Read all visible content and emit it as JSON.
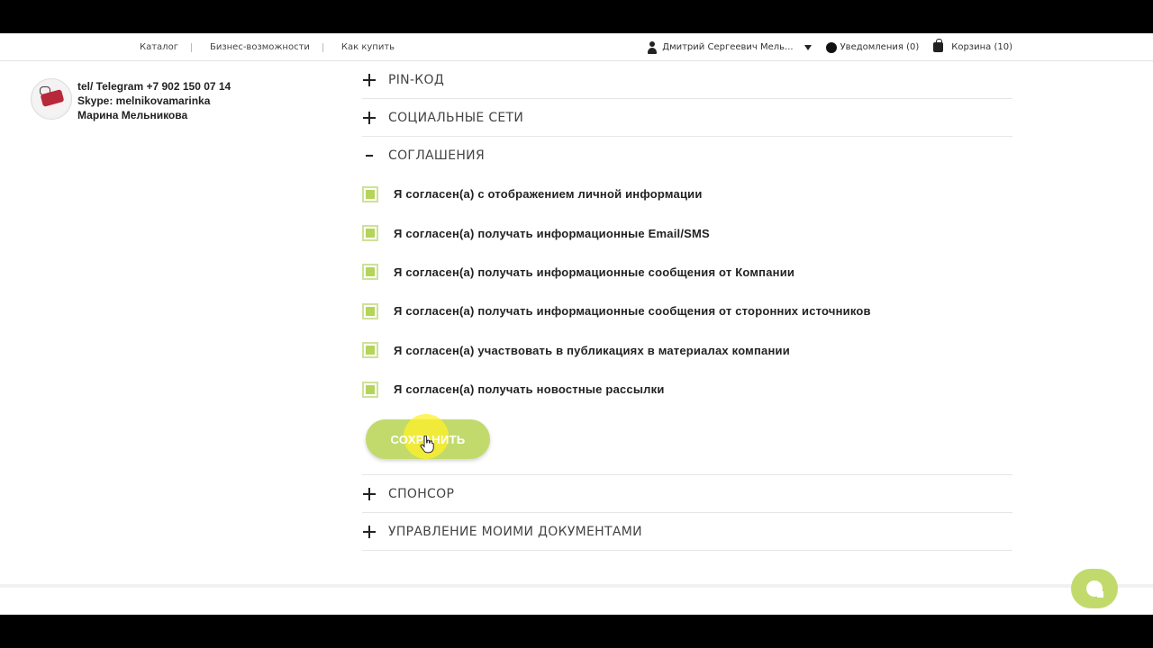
{
  "topnav": {
    "links": [
      "Каталог",
      "Бизнес-возможности",
      "Как купить"
    ],
    "user_name": "Дмитрий Сергеевич Мель...",
    "notifications": "Уведомления (0)",
    "cart": "Корзина (10)"
  },
  "contact": {
    "line1": "tel/ Telegram  +7 902 150 07 14",
    "line2": "Skype: melnikovamarinka",
    "line3": "Марина Мельникова"
  },
  "sections": {
    "pin": "PIN-КОД",
    "social": "СОЦИАЛЬНЫЕ СЕТИ",
    "agreements": "СОГЛАШЕНИЯ",
    "sponsor": "СПОНСОР",
    "documents": "УПРАВЛЕНИЕ МОИМИ ДОКУМЕНТАМИ"
  },
  "agreements": [
    "Я согласен(а) с отображением личной информации",
    "Я согласен(а) получать информационные Email/SMS",
    "Я согласен(а) получать информационные сообщения от Компании",
    "Я согласен(а) получать информационные сообщения от сторонних источников",
    "Я согласен(а) участвовать в публикациях в материалах компании",
    "Я согласен(а) получать новостные рассылки"
  ],
  "save_label": "СОХРАНИТЬ",
  "colors": {
    "accent": "#c2da6c",
    "checkbox_fill": "#b5d45a",
    "cursor_highlight": "#fff028"
  },
  "icons": {
    "user": "user-icon",
    "dropdown": "caret-down-icon",
    "notifications": "bell-icon",
    "cart": "shopping-bag-icon",
    "expand": "plus-icon",
    "collapse": "minus-icon",
    "chat": "chat-icon",
    "cursor": "hand-pointer-icon"
  }
}
